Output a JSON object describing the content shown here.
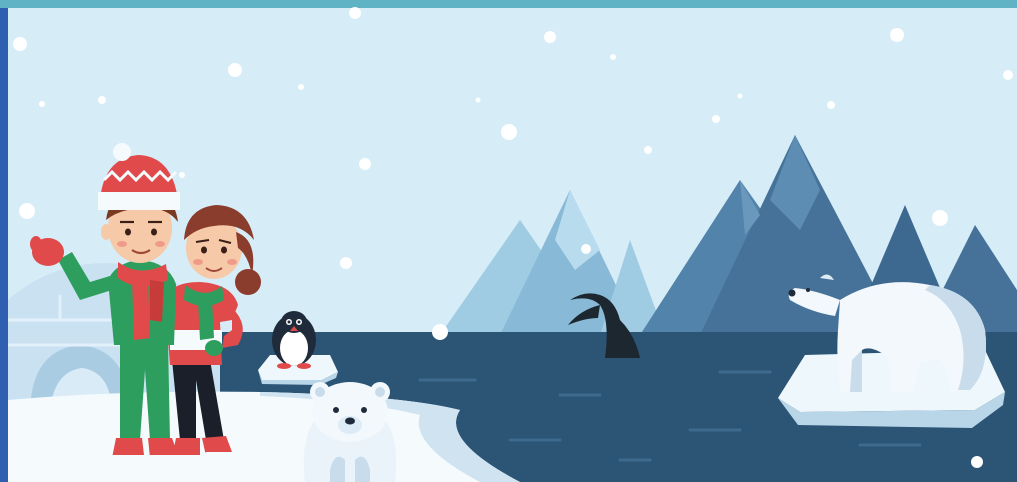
{
  "scene": {
    "colors": {
      "frame_top": "#5fb3c4",
      "frame_side": "#2f5fb0",
      "sky": "#d6ecf7",
      "mountain_far": "#9fcbe3",
      "mountain_mid": "#88b9d6",
      "mountain_near": "#46729a",
      "mountain_shadow": "#2f5677",
      "sea": "#2c5475",
      "ice": "#eef7fc",
      "ice_shadow": "#c2dbec",
      "snow_ground": "#f5fafd",
      "bear": "#f2f8fc",
      "bear_shade": "#c8dcec"
    },
    "icons": [
      "snowflake-icon",
      "igloo-icon",
      "penguin-icon",
      "whale-tail-icon",
      "polar-bear-icon",
      "bear-cub-icon",
      "boy-icon",
      "girl-icon"
    ]
  }
}
